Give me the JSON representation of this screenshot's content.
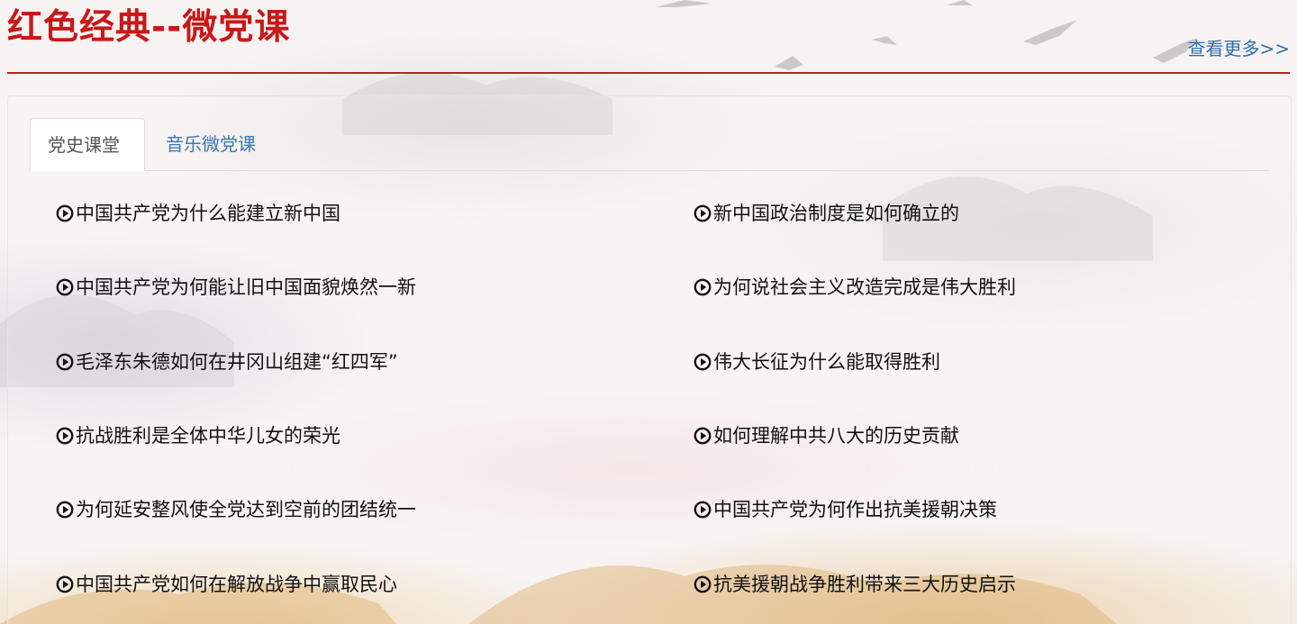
{
  "header": {
    "title": "红色经典--微党课",
    "more_label": "查看更多>>"
  },
  "tabs": [
    {
      "label": "党史课堂",
      "active": true
    },
    {
      "label": "音乐微党课",
      "active": false
    }
  ],
  "lessons": {
    "left": [
      "中国共产党为什么能建立新中国",
      "中国共产党为何能让旧中国面貌焕然一新",
      "毛泽东朱德如何在井冈山组建“红四军”",
      "抗战胜利是全体中华儿女的荣光",
      "为何延安整风使全党达到空前的团结统一",
      "中国共产党如何在解放战争中赢取民心"
    ],
    "right": [
      "新中国政治制度是如何确立的",
      "为何说社会主义改造完成是伟大胜利",
      "伟大长征为什么能取得胜利",
      "如何理解中共八大的历史贡献",
      "中国共产党为何作出抗美援朝决策",
      "抗美援朝战争胜利带来三大历史启示"
    ]
  },
  "icons": {
    "item_icon": "play-circle-icon"
  },
  "colors": {
    "title_red": "#c81818",
    "rule_red": "#b3261e",
    "link_blue": "#2f6ea8",
    "tab_blue": "#3a78b5"
  }
}
